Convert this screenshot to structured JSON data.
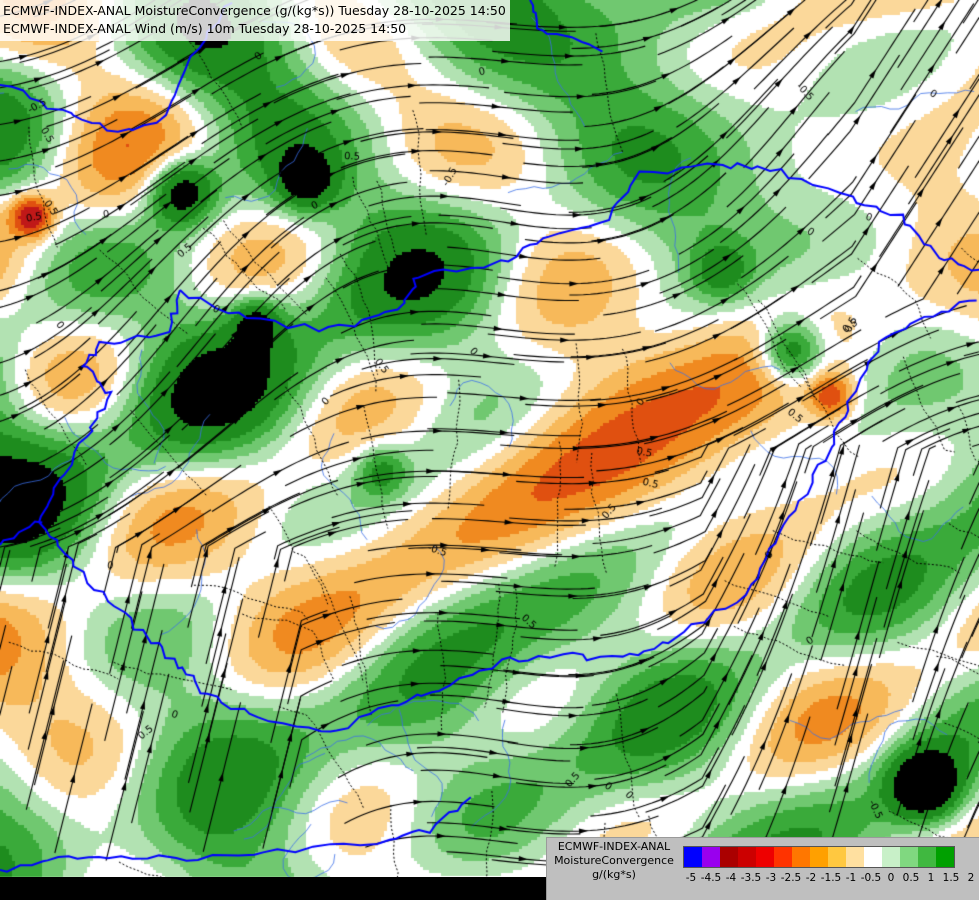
{
  "title": {
    "line1": "ECMWF-INDEX-ANAL MoistureConvergence (g/(kg*s)) Tuesday 28-10-2025 14:50",
    "line2": "ECMWF-INDEX-ANAL Wind (m/s) 10m Tuesday 28-10-2025 14:50"
  },
  "legend": {
    "model": "ECMWF-INDEX-ANAL",
    "parameter": "MoistureConvergence",
    "unit": "g/(kg*s)",
    "ticks": [
      "-5",
      "-4.5",
      "-4",
      "-3.5",
      "-3",
      "-2.5",
      "-2",
      "-1.5",
      "-1",
      "-0.5",
      "0",
      "0.5",
      "1",
      "1.5",
      "2"
    ],
    "colors": [
      "#0000ff",
      "#9900ee",
      "#aa0000",
      "#cc0000",
      "#ee0000",
      "#ff3300",
      "#ff7700",
      "#ffa000",
      "#ffc840",
      "#ffe0a0",
      "#ffffff",
      "#c8f0c8",
      "#80d880",
      "#40b840",
      "#00a000"
    ]
  },
  "map": {
    "contour_labels": [
      "0",
      "0",
      "0",
      "0",
      "0",
      "0",
      "0",
      "0",
      "0",
      "0",
      "0",
      "0",
      "0",
      "0",
      "0",
      "0",
      "0",
      "0",
      "0",
      "0",
      "0.5",
      "0.5",
      "0.5",
      "0.5",
      "0.5",
      "0.5",
      "0.5",
      "0.5",
      "0.5",
      "0.5",
      "0.5",
      "0.5",
      "0.5",
      "0.5",
      "0.5",
      "-0.5",
      "-0.5",
      "-0.5",
      "-0.5",
      "-0.5"
    ],
    "colors": {
      "border": "#0000ff",
      "river": "#3a6ee8",
      "streamline": "#000000",
      "contour": "#000000"
    }
  }
}
